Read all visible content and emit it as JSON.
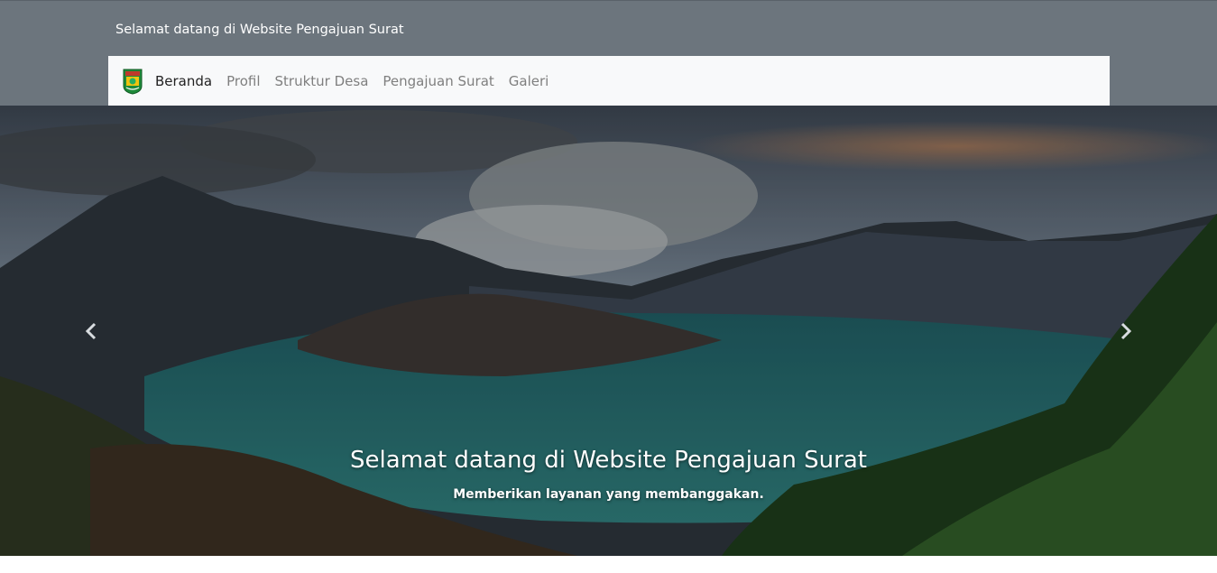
{
  "header": {
    "site_title": "Selamat datang di Website Pengajuan Surat"
  },
  "navbar": {
    "logo_icon": "village-emblem-icon",
    "items": [
      {
        "label": "Beranda",
        "active": true
      },
      {
        "label": "Profil",
        "active": false
      },
      {
        "label": "Struktur Desa",
        "active": false
      },
      {
        "label": "Pengajuan Surat",
        "active": false
      },
      {
        "label": "Galeri",
        "active": false
      }
    ]
  },
  "carousel": {
    "caption_title": "Selamat datang di Website Pengajuan Surat",
    "caption_text": "Memberikan layanan yang membanggakan.",
    "prev_icon": "chevron-left-icon",
    "next_icon": "chevron-right-icon"
  },
  "colors": {
    "header_bg": "#6c757d",
    "navbar_bg": "#f8f9fa",
    "nav_active": "#222222",
    "nav_inactive": "#7f7f7f"
  }
}
